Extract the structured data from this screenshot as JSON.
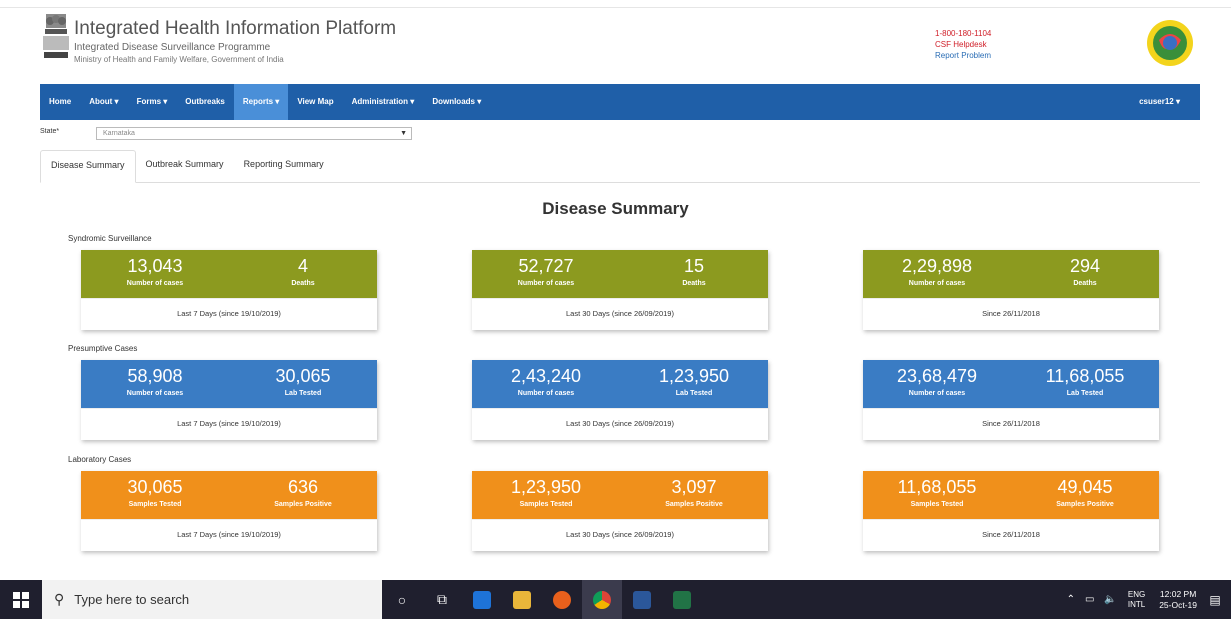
{
  "header": {
    "title": "Integrated Health Information Platform",
    "subtitle1": "Integrated Disease Surveillance Programme",
    "subtitle2": "Ministry of Health and Family Welfare, Government of India",
    "helpline_number": "1-800-180-1104",
    "helpdesk": "CSF Helpdesk",
    "report_problem": "Report Problem"
  },
  "nav": {
    "home": "Home",
    "about": "About ▾",
    "forms": "Forms ▾",
    "outbreaks": "Outbreaks",
    "reports": "Reports ▾",
    "view_map": "View Map",
    "administration": "Administration ▾",
    "downloads": "Downloads ▾",
    "user": "csuser12 ▾"
  },
  "state": {
    "label": "State*",
    "selected": "Karnataka"
  },
  "tabs": [
    "Disease Summary",
    "Outbreak Summary",
    "Reporting Summary"
  ],
  "summary_title": "Disease Summary",
  "sections": [
    {
      "label": "Syndromic Surveillance",
      "cards": [
        {
          "v1": "13,043",
          "l1": "Number of cases",
          "v2": "4",
          "l2": "Deaths",
          "foot": "Last 7 Days (since 19/10/2019)"
        },
        {
          "v1": "52,727",
          "l1": "Number of cases",
          "v2": "15",
          "l2": "Deaths",
          "foot": "Last 30 Days (since 26/09/2019)"
        },
        {
          "v1": "2,29,898",
          "l1": "Number of cases",
          "v2": "294",
          "l2": "Deaths",
          "foot": "Since 26/11/2018"
        }
      ]
    },
    {
      "label": "Presumptive Cases",
      "cards": [
        {
          "v1": "58,908",
          "l1": "Number of cases",
          "v2": "30,065",
          "l2": "Lab Tested",
          "foot": "Last 7 Days (since 19/10/2019)"
        },
        {
          "v1": "2,43,240",
          "l1": "Number of cases",
          "v2": "1,23,950",
          "l2": "Lab Tested",
          "foot": "Last 30 Days (since 26/09/2019)"
        },
        {
          "v1": "23,68,479",
          "l1": "Number of cases",
          "v2": "11,68,055",
          "l2": "Lab Tested",
          "foot": "Since 26/11/2018"
        }
      ]
    },
    {
      "label": "Laboratory Cases",
      "cards": [
        {
          "v1": "30,065",
          "l1": "Samples Tested",
          "v2": "636",
          "l2": "Samples Positive",
          "foot": "Last 7 Days (since 19/10/2019)"
        },
        {
          "v1": "1,23,950",
          "l1": "Samples Tested",
          "v2": "3,097",
          "l2": "Samples Positive",
          "foot": "Last 30 Days (since 26/09/2019)"
        },
        {
          "v1": "11,68,055",
          "l1": "Samples Tested",
          "v2": "49,045",
          "l2": "Samples Positive",
          "foot": "Since 26/11/2018"
        }
      ]
    }
  ],
  "colors": {
    "navbar": "#1f5fa8",
    "syndromic": "#8c9a1f",
    "presumptive": "#3a7cc4",
    "laboratory": "#f0901b"
  },
  "taskbar": {
    "search_placeholder": "Type here to search",
    "lang_top": "ENG",
    "lang_bottom": "INTL",
    "time": "12:02 PM",
    "date": "25-Oct-19",
    "icons": [
      "windows-icon",
      "cortana-icon",
      "task-view-icon",
      "edge-icon",
      "file-explorer-icon",
      "firefox-icon",
      "chrome-icon",
      "word-icon",
      "excel-icon"
    ]
  }
}
